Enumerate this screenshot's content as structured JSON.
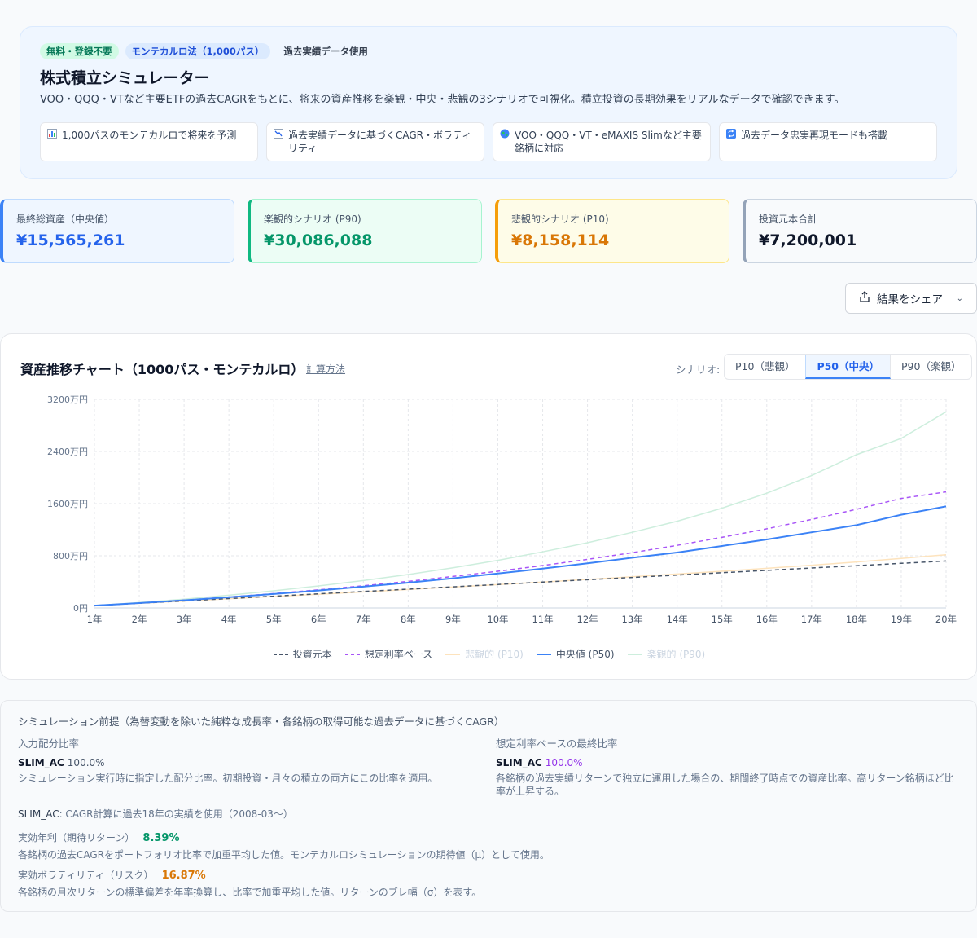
{
  "hero": {
    "badges": [
      "無料・登録不要",
      "モンテカルロ法（1,000パス）",
      "過去実績データ使用"
    ],
    "title": "株式積立シミュレーター",
    "description": "VOO・QQQ・VTなど主要ETFの過去CAGRをもとに、将来の資産推移を楽観・中央・悲観の3シナリオで可視化。積立投資の長期効果をリアルなデータで確認できます。",
    "features": [
      {
        "icon": "chart-icon",
        "text": "1,000パスのモンテカルロで将来を予測"
      },
      {
        "icon": "trend-icon",
        "text": "過去実績データに基づくCAGR・ボラティリティ"
      },
      {
        "icon": "globe-icon",
        "text": "VOO・QQQ・VT・eMAXIS Slimなど主要銘柄に対応"
      },
      {
        "icon": "repeat-icon",
        "text": "過去データ忠実再現モードも搭載"
      }
    ]
  },
  "stats": [
    {
      "label": "最終総資産（中央値）",
      "value": "¥15,565,261"
    },
    {
      "label": "楽観的シナリオ (P90)",
      "value": "¥30,086,088"
    },
    {
      "label": "悲観的シナリオ (P10)",
      "value": "¥8,158,114"
    },
    {
      "label": "投資元本合計",
      "value": "¥7,200,001"
    }
  ],
  "share_button": "結果をシェア",
  "chart_card": {
    "title": "資産推移チャート（1000パス・モンテカルロ）",
    "calc_link": "計算方法",
    "scenario_label": "シナリオ:",
    "scenarios": [
      "P10（悲観）",
      "P50（中央）",
      "P90（楽観）"
    ],
    "active_scenario": "P50（中央）"
  },
  "chart_data": {
    "type": "line",
    "x": [
      "1年",
      "2年",
      "3年",
      "4年",
      "5年",
      "6年",
      "7年",
      "8年",
      "9年",
      "10年",
      "11年",
      "12年",
      "13年",
      "14年",
      "15年",
      "16年",
      "17年",
      "18年",
      "19年",
      "20年"
    ],
    "y_ticks": [
      "0円",
      "800万円",
      "1600万円",
      "2400万円",
      "3200万円"
    ],
    "ylim": [
      0,
      3200
    ],
    "y_unit": "万円",
    "grid": true,
    "legend_position": "bottom",
    "series": [
      {
        "name": "投資元本",
        "color": "#475569",
        "dash": true,
        "dim": false,
        "values": [
          36,
          72,
          108,
          144,
          180,
          216,
          252,
          288,
          324,
          360,
          396,
          432,
          468,
          504,
          540,
          576,
          612,
          648,
          684,
          720
        ]
      },
      {
        "name": "想定利率ベース",
        "color": "#a855f7",
        "dash": true,
        "dim": false,
        "values": [
          36,
          76,
          120,
          168,
          220,
          277,
          340,
          408,
          482,
          562,
          650,
          745,
          848,
          960,
          1082,
          1214,
          1357,
          1512,
          1680,
          1780
        ]
      },
      {
        "name": "悲観的 (P10)",
        "color": "#fde3bd",
        "dash": false,
        "dim": true,
        "values": [
          36,
          70,
          105,
          140,
          175,
          210,
          245,
          282,
          320,
          358,
          397,
          437,
          478,
          520,
          563,
          608,
          655,
          705,
          760,
          816
        ]
      },
      {
        "name": "中央値 (P50)",
        "color": "#3b82f6",
        "dash": false,
        "dim": false,
        "values": [
          36,
          75,
          118,
          164,
          214,
          268,
          326,
          388,
          455,
          527,
          603,
          684,
          770,
          850,
          950,
          1050,
          1160,
          1270,
          1430,
          1557
        ]
      },
      {
        "name": "楽観的 (P90)",
        "color": "#cdeedd",
        "dash": false,
        "dim": true,
        "values": [
          36,
          82,
          135,
          195,
          262,
          337,
          420,
          512,
          615,
          730,
          860,
          1000,
          1160,
          1330,
          1530,
          1760,
          2030,
          2350,
          2600,
          3009
        ]
      }
    ]
  },
  "assumptions": {
    "heading": "シミュレーション前提（為替変動を除いた純粋な成長率・各銘柄の取得可能な過去データに基づくCAGR）",
    "input_title": "入力配分比率",
    "input_code": "SLIM_AC",
    "input_pct": "100.0%",
    "input_note": "シミュレーション実行時に指定した配分比率。初期投資・月々の積立の両方にこの比率を適用。",
    "final_title": "想定利率ベースの最終比率",
    "final_code": "SLIM_AC",
    "final_pct": "100.0%",
    "final_note": "各銘柄の過去実績リターンで独立に運用した場合の、期間終了時点での資産比率。高リターン銘柄ほど比率が上昇する。",
    "cagr_code": "SLIM_AC",
    "cagr_note": ": CAGR計算に過去18年の実績を使用（2008-03〜）",
    "return_label": "実効年利（期待リターン）",
    "return_value": "8.39%",
    "return_note": "各銘柄の過去CAGRをポートフォリオ比率で加重平均した値。モンテカルロシミュレーションの期待値（μ）として使用。",
    "vol_label": "実効ボラティリティ（リスク）",
    "vol_value": "16.87%",
    "vol_note": "各銘柄の月次リターンの標準偏差を年率換算し、比率で加重平均した値。リターンのブレ幅（σ）を表す。"
  }
}
